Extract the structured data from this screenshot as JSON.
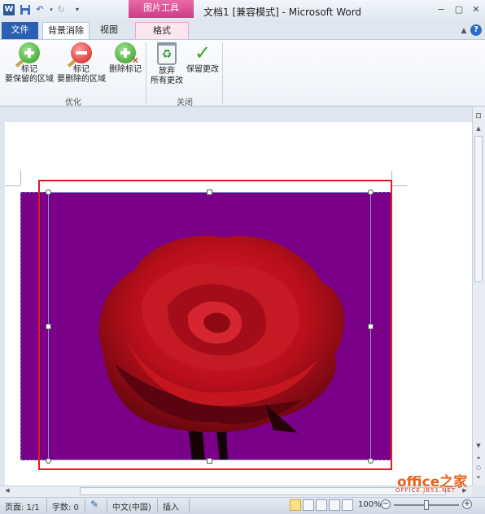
{
  "titlebar": {
    "app_icon": "word-icon",
    "app_icon_letter": "W",
    "context_tab_group": "图片工具",
    "title": "文档1 [兼容模式] - Microsoft Word"
  },
  "tabs": {
    "file": "文件",
    "background_removal": "背景消除",
    "view": "视图",
    "format": "格式"
  },
  "ribbon": {
    "mark_keep": {
      "line1": "标记",
      "line2": "要保留的区域"
    },
    "mark_remove": {
      "line1": "标记",
      "line2": "要删除的区域"
    },
    "delete_mark": {
      "line1": "删除标记"
    },
    "group_refine": "优化",
    "discard": {
      "line1": "放弃",
      "line2": "所有更改"
    },
    "keep_changes": {
      "line1": "保留更改"
    },
    "group_close": "关闭"
  },
  "status": {
    "page": "页面: 1/1",
    "words": "字数: 0",
    "language": "中文(中国)",
    "mode": "插入",
    "zoom": "100%",
    "zoom_level_percent": 100
  },
  "watermark": {
    "brand": "office之家",
    "url": "OFFICE.JB51.NET"
  },
  "colors": {
    "accent": "#2b5fb4",
    "picture_tools": "#cf3b86",
    "removal_background": "#7b0088",
    "highlight_box": "#e21a22",
    "rose": "#c8101c"
  }
}
